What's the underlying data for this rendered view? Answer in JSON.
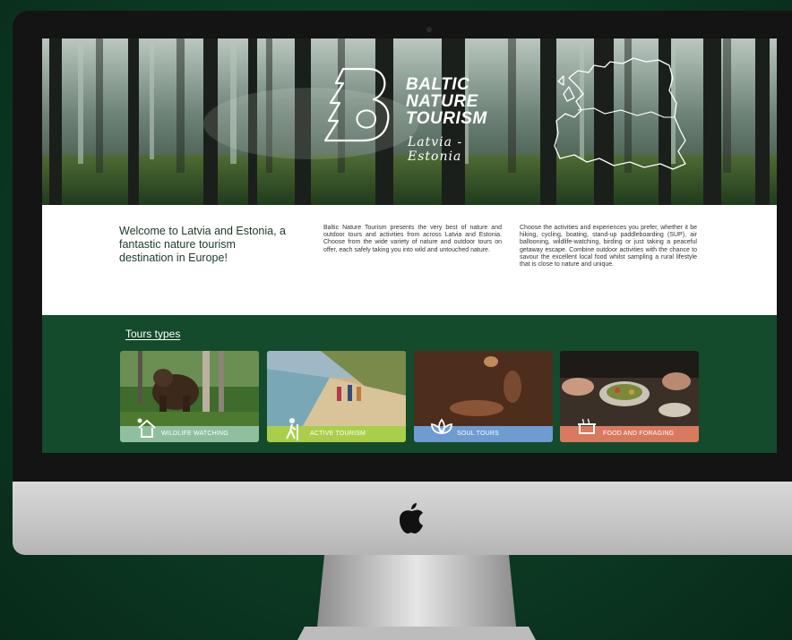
{
  "hero": {
    "brand_line1": "BALTIC",
    "brand_line2": "NATURE",
    "brand_line3": "TOURISM",
    "subtitle_line1": "Latvia -",
    "subtitle_line2": "Estonia"
  },
  "intro": {
    "welcome": "Welcome to Latvia and Estonia, a fantastic nature tourism destination in Europe!",
    "column1": "Baltic Nature Tourism presents the very best of nature and outdoor tours and activities from across Latvia and Estonia. Choose from the wide variety of nature and outdoor tours on offer, each safely taking you into wild and untouched nature.",
    "column2": "Choose the activities and experiences you prefer, whether it be hiking, cycling, boating, stand-up paddleboarding (SUP), air ballooning, wildlife-watching, birding or just taking a peaceful getaway escape. Combine outdoor activities with the chance to savour the excellent local food whilst sampling a rural lifestyle that is close to nature and unique."
  },
  "tours": {
    "heading": "Tours types",
    "cards": [
      {
        "label": "WILDLIFE WATCHING",
        "icon": "binoculars-tower-icon",
        "color": "#8fbf9f"
      },
      {
        "label": "ACTIVE TOURISM",
        "icon": "hiker-icon",
        "color": "#a9cf4a"
      },
      {
        "label": "SOUL TOURS",
        "icon": "lotus-icon",
        "color": "#6f9bd1"
      },
      {
        "label": "FOOD AND FORAGING",
        "icon": "pot-icon",
        "color": "#d9795f"
      }
    ]
  },
  "colors": {
    "background": "#0d3a22",
    "tours_band": "#134b2c",
    "heading_text": "#1c3a28"
  }
}
